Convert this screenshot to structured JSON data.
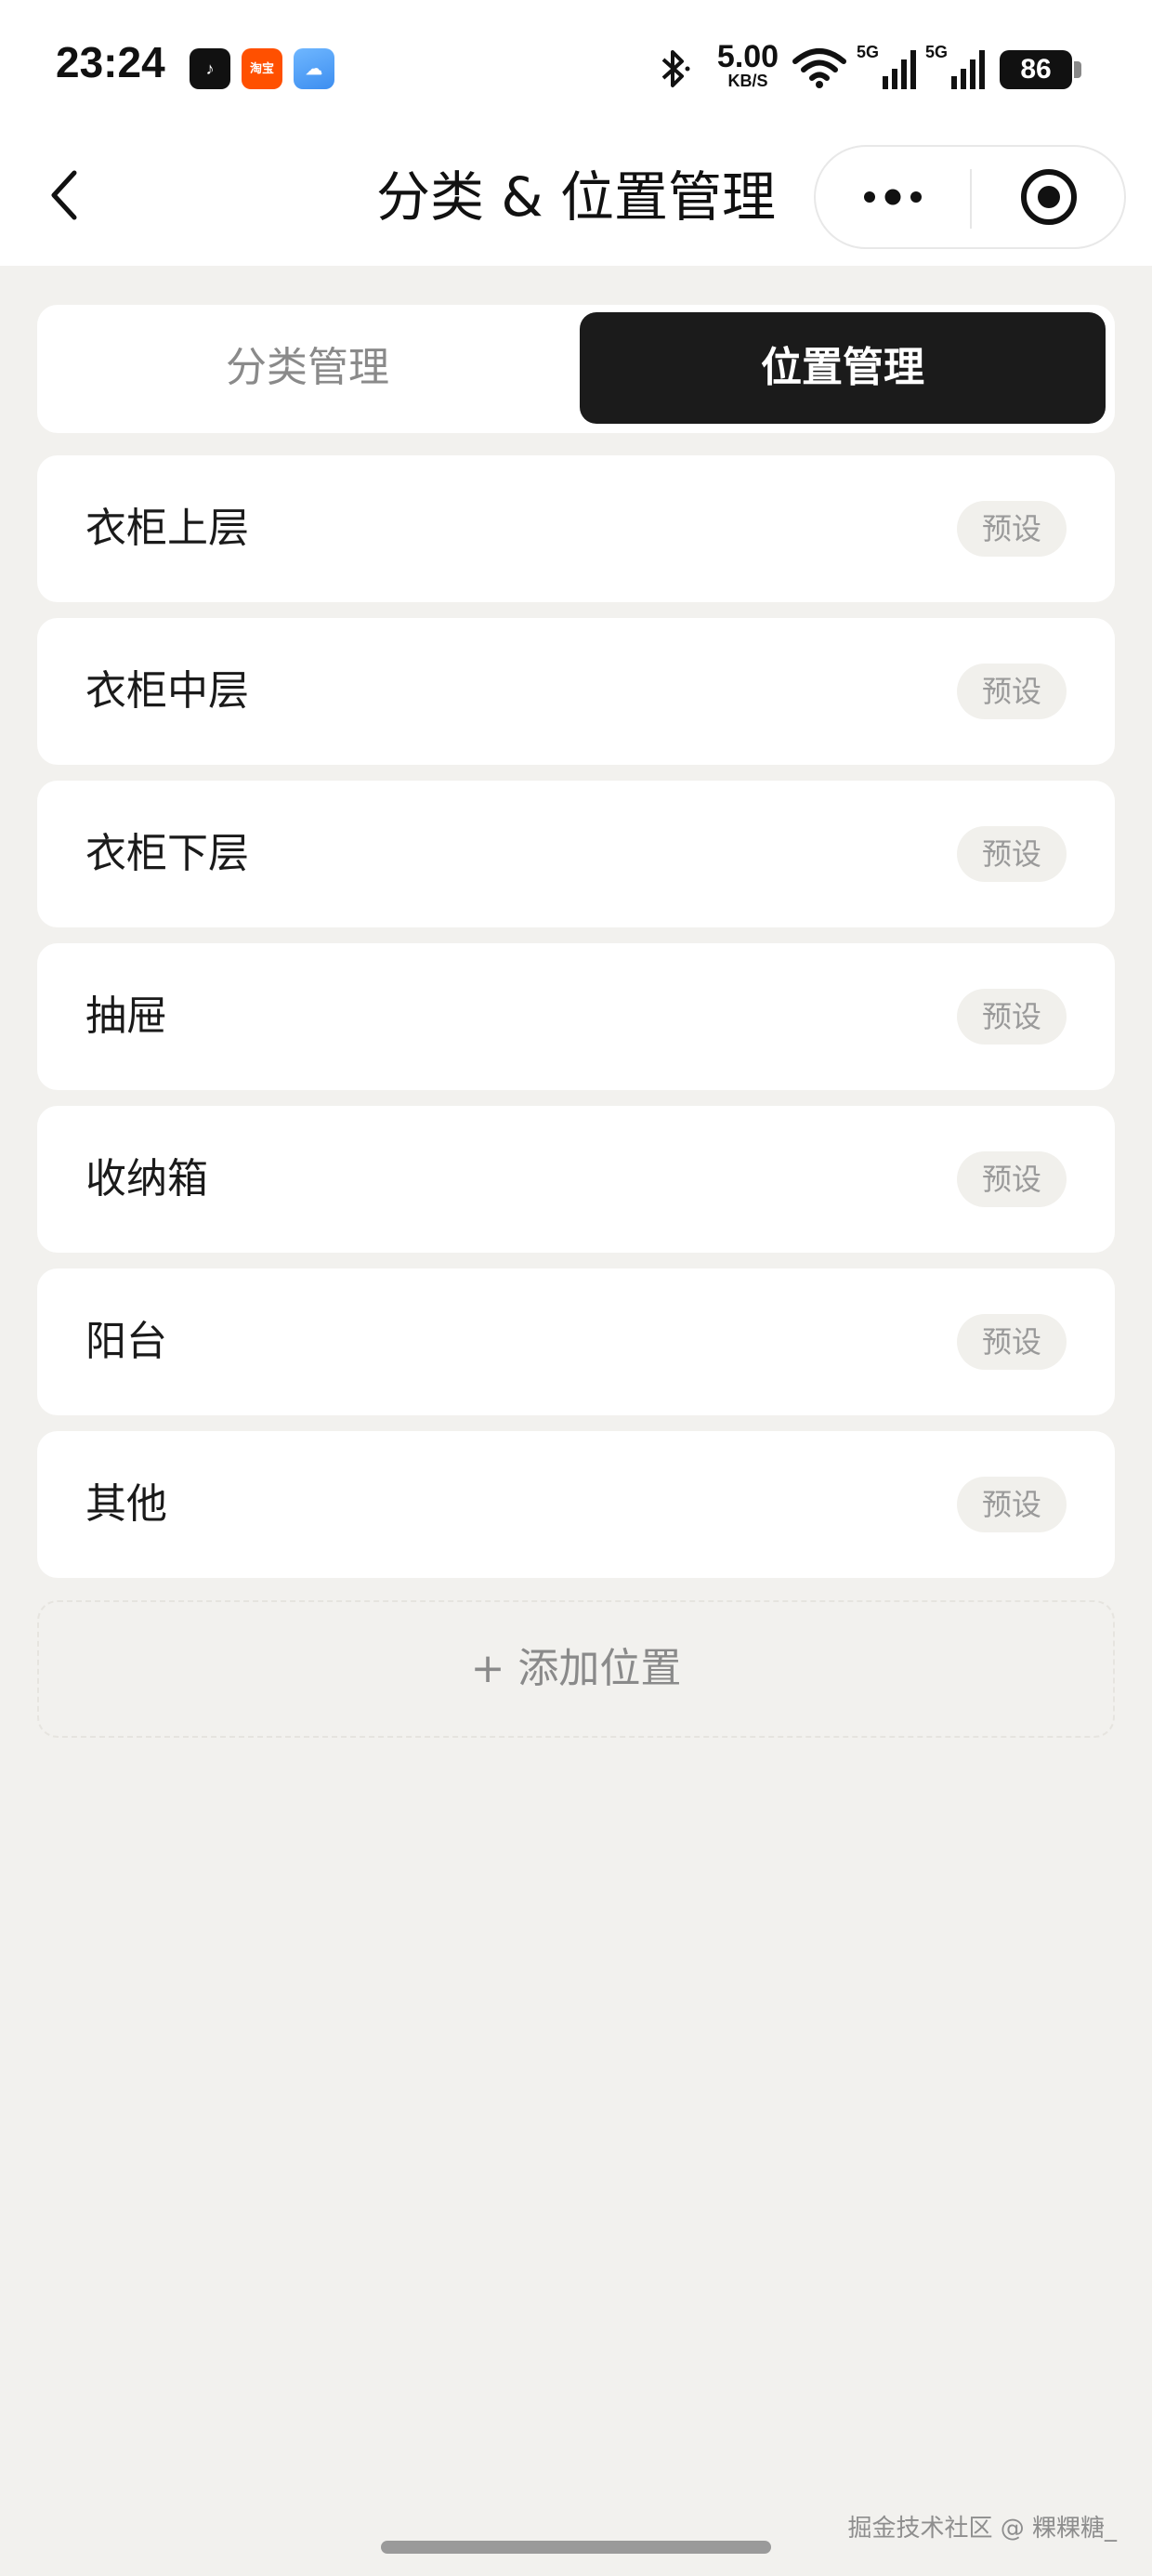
{
  "status_bar": {
    "time": "23:24",
    "apps": [
      {
        "name": "tiktok-app-icon",
        "glyph": "♪"
      },
      {
        "name": "taobao-app-icon",
        "glyph": "淘宝"
      },
      {
        "name": "weather-app-icon",
        "glyph": "☁"
      }
    ],
    "net_speed_value": "5.00",
    "net_speed_unit": "KB/S",
    "signal_1_label": "5G",
    "signal_2_label": "5G",
    "battery": "86"
  },
  "nav": {
    "title": "分类 & 位置管理"
  },
  "tabs": [
    {
      "label": "分类管理",
      "active": false
    },
    {
      "label": "位置管理",
      "active": true
    }
  ],
  "locations": [
    {
      "label": "衣柜上层",
      "badge": "预设"
    },
    {
      "label": "衣柜中层",
      "badge": "预设"
    },
    {
      "label": "衣柜下层",
      "badge": "预设"
    },
    {
      "label": "抽屉",
      "badge": "预设"
    },
    {
      "label": "收纳箱",
      "badge": "预设"
    },
    {
      "label": "阳台",
      "badge": "预设"
    },
    {
      "label": "其他",
      "badge": "预设"
    }
  ],
  "add_button_label": "+ 添加位置",
  "watermark": "掘金技术社区 @ 粿粿糖_",
  "colors": {
    "background": "#f2f1ee",
    "active_tab": "#1b1b1b",
    "badge_bg": "#f1f0ec"
  }
}
